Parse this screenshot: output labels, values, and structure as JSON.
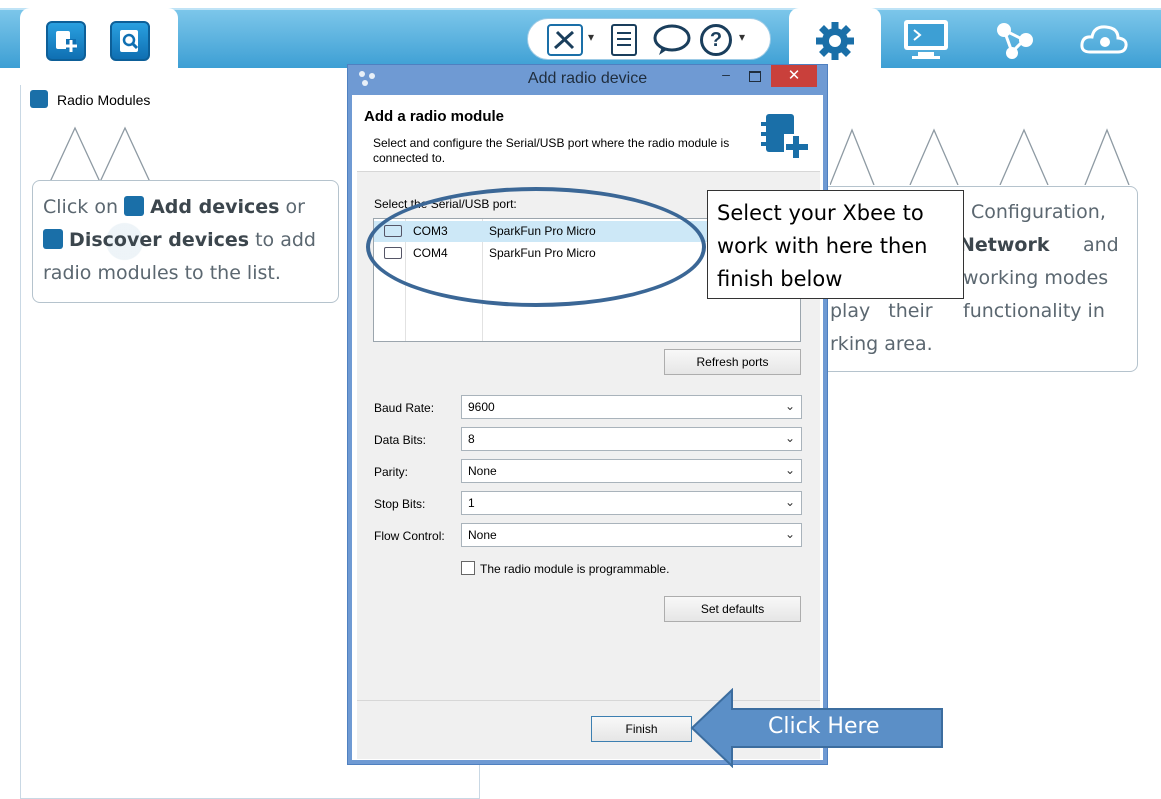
{
  "left_panel": {
    "title": "Radio Modules",
    "hint_pre": "Click on",
    "hint_add": "Add devices",
    "hint_or": "or",
    "hint_discover": "Discover devices",
    "hint_post": "to add radio modules to the list."
  },
  "right_panel": {
    "line1": "Configuration,",
    "line2a": "Network",
    "line2b": "and",
    "line3": "working modes",
    "line4a": "play their",
    "line4b": "functionality in",
    "line5": "rking area."
  },
  "dialog": {
    "window_title": "Add radio device",
    "heading": "Add a radio module",
    "description": "Select and configure the Serial/USB port where the radio module is connected to.",
    "port_label": "Select the Serial/USB port:",
    "ports": [
      {
        "port": "COM3",
        "name": "SparkFun Pro Micro",
        "selected": true
      },
      {
        "port": "COM4",
        "name": "SparkFun Pro Micro",
        "selected": false
      }
    ],
    "refresh_label": "Refresh ports",
    "fields": {
      "baud_label": "Baud Rate:",
      "baud_value": "9600",
      "data_label": "Data Bits:",
      "data_value": "8",
      "parity_label": "Parity:",
      "parity_value": "None",
      "stop_label": "Stop Bits:",
      "stop_value": "1",
      "flow_label": "Flow Control:",
      "flow_value": "None"
    },
    "programmable_label": "The radio module is programmable.",
    "programmable_checked": false,
    "set_defaults_label": "Set defaults",
    "finish_label": "Finish"
  },
  "annotations": {
    "callout_text_1": "Select your Xbee to",
    "callout_text_2": "work with here then",
    "callout_text_3": "finish below",
    "arrow_text": "Click Here"
  },
  "colors": {
    "toolbar_blue": "#3d9fd4",
    "dialog_border": "#6f9ad3",
    "close_red": "#c9403b",
    "selection": "#cde8f7",
    "arrow_fill": "#5b8fc7"
  }
}
